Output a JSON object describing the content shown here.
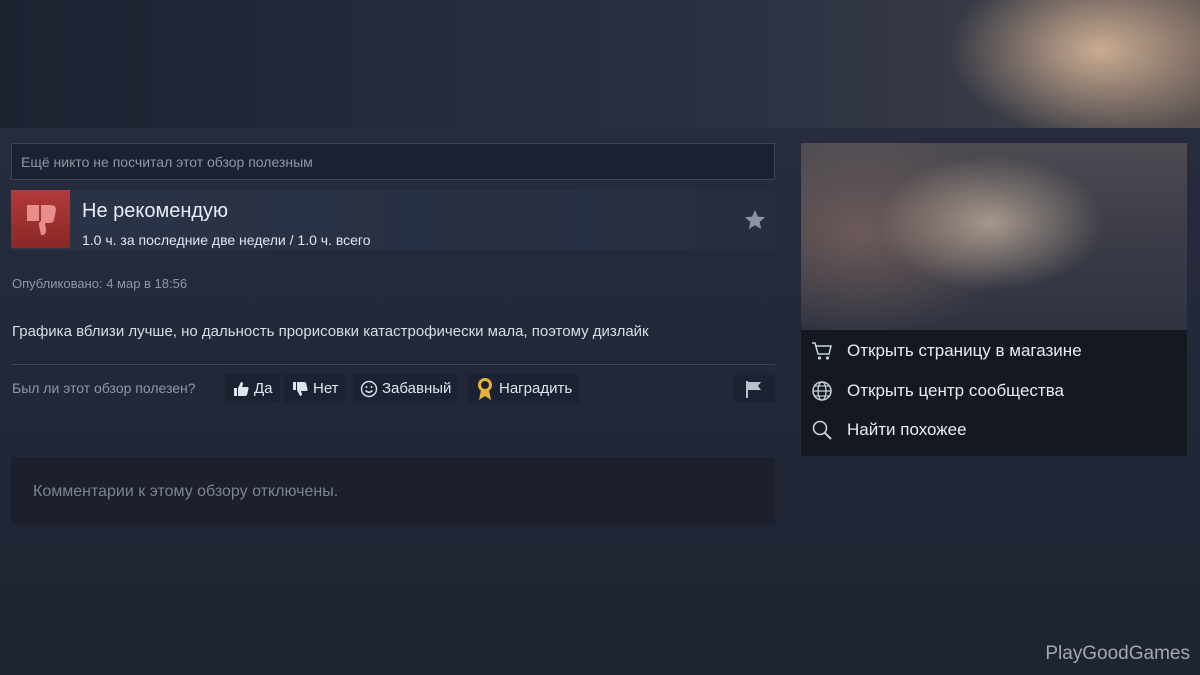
{
  "review": {
    "helpful_count_text": "Ещё никто не посчитал этот обзор полезным",
    "verdict": "Не рекомендую",
    "hours": "1.0 ч. за последние две недели / 1.0 ч. всего",
    "posted": "Опубликовано: 4 мар в 18:56",
    "text": "Графика вблизи лучше, но дальность прорисовки катастрофически мала, поэтому дизлайк",
    "comments_disabled": "Комментарии к этому обзору отключены."
  },
  "vote": {
    "question": "Был ли этот обзор полезен?",
    "yes_label": "Да",
    "no_label": "Нет",
    "funny_label": "Забавный",
    "award_label": "Наградить"
  },
  "sidebar": {
    "links": [
      {
        "label": "Открыть страницу в магазине",
        "icon": "cart-icon"
      },
      {
        "label": "Открыть центр сообщества",
        "icon": "globe-icon"
      },
      {
        "label": "Найти похожее",
        "icon": "search-icon"
      }
    ]
  },
  "watermark": "PlayGoodGames",
  "colors": {
    "thumb_down_bg": "#a33232",
    "panel_bg": "#141821",
    "award_gold": "#e6b23a"
  }
}
